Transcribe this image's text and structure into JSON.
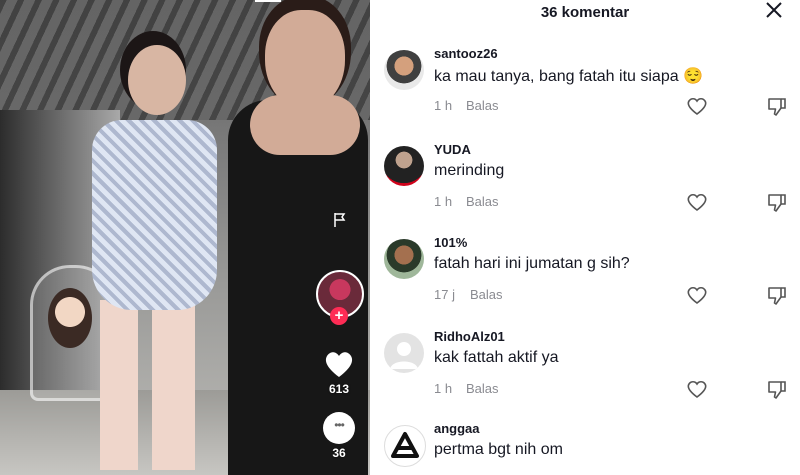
{
  "video": {
    "like_count": "613",
    "comment_count": "36",
    "icons": {
      "report": "flag-icon",
      "like": "heart-icon",
      "comment": "comment-bubble-icon",
      "follow": "plus-icon"
    }
  },
  "panel": {
    "title": "36 komentar",
    "close_icon": "close-icon",
    "comments": [
      {
        "username": "santooz26",
        "text": "ka mau tanya, bang fatah itu siapa 😌",
        "time": "1 h",
        "reply": "Balas"
      },
      {
        "username": "YUDA",
        "text": "merinding",
        "time": "1 h",
        "reply": "Balas"
      },
      {
        "username": "101%",
        "text": "fatah hari ini jumatan g sih?",
        "time": "17 j",
        "reply": "Balas"
      },
      {
        "username": "RidhoAlz01",
        "text": "kak fattah aktif ya",
        "time": "1 h",
        "reply": "Balas"
      },
      {
        "username": "anggaa",
        "text": "pertma bgt nih om"
      }
    ]
  },
  "colors": {
    "accent": "#fe2c55",
    "text": "#161823",
    "muted": "#8a8b91"
  }
}
